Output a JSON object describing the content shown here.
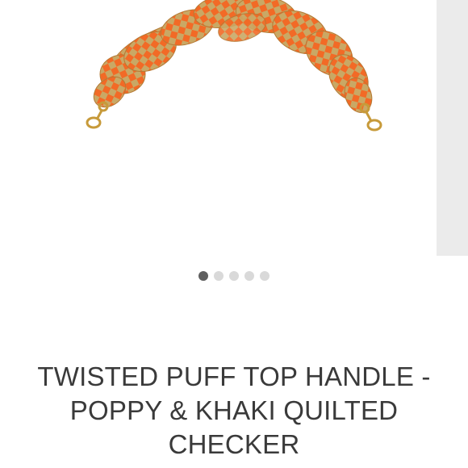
{
  "product": {
    "title": "TWISTED PUFF TOP HANDLE - POPPY & KHAKI QUILTED CHECKER",
    "image_alt_colors": {
      "poppy": "#f26a26",
      "khaki": "#c9a865",
      "hardware": "#c79a3a"
    }
  },
  "carousel": {
    "slide_count": 5,
    "active_index": 0
  }
}
